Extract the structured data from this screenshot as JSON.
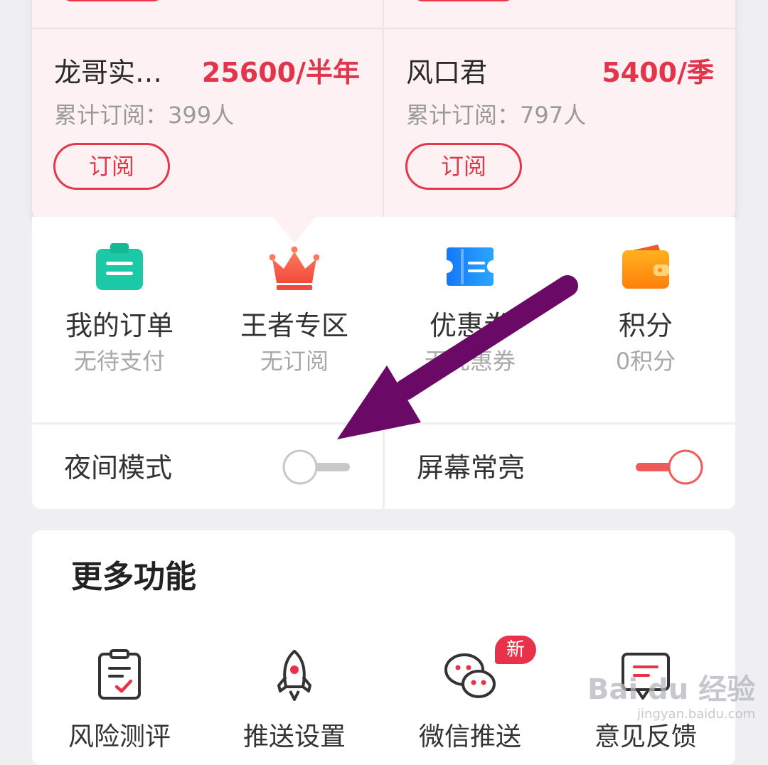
{
  "subscriptions": [
    {
      "name": "龙哥实…",
      "price": "25600/半年",
      "subscribers": "累计订阅：399人",
      "button": "订阅"
    },
    {
      "name": "风口君",
      "price": "5400/季",
      "subscribers": "累计订阅：797人",
      "button": "订阅"
    }
  ],
  "quick_actions": [
    {
      "icon": "orders-clipboard-icon",
      "label": "我的订单",
      "sub": "无待支付"
    },
    {
      "icon": "crown-icon",
      "label": "王者专区",
      "sub": "无订阅"
    },
    {
      "icon": "coupon-icon",
      "label": "优惠券",
      "sub": "无优惠券"
    },
    {
      "icon": "wallet-icon",
      "label": "积分",
      "sub": "0积分"
    }
  ],
  "toggles": [
    {
      "label": "夜间模式",
      "on": false
    },
    {
      "label": "屏幕常亮",
      "on": true
    }
  ],
  "more_functions": {
    "title": "更多功能",
    "items": [
      {
        "icon": "risk-assessment-icon",
        "label": "风险测评"
      },
      {
        "icon": "rocket-icon",
        "label": "推送设置"
      },
      {
        "icon": "wechat-icon",
        "label": "微信推送",
        "badge": "新"
      },
      {
        "icon": "feedback-icon",
        "label": "意见反馈"
      }
    ]
  },
  "annotation": {
    "color": "#6b0a66",
    "shape": "arrow"
  },
  "watermark": {
    "main": "Bai du 经验",
    "sub": "jingyan.baidu.com"
  },
  "colors": {
    "accent": "#e2344a",
    "toggle_on": "#ef5b5b",
    "toggle_off": "#c8c8c8"
  }
}
